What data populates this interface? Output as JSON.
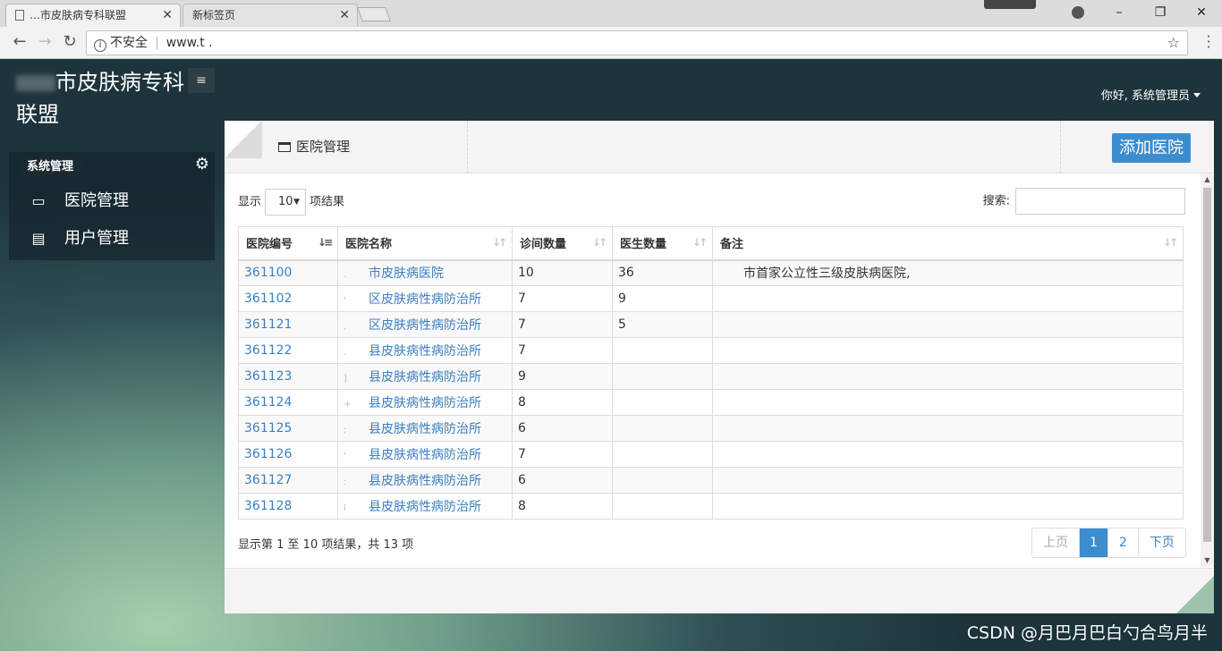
{
  "browser": {
    "tabs": [
      {
        "title": "…市皮肤病专科联盟",
        "active": true
      },
      {
        "title": "新标签页",
        "active": false
      }
    ],
    "security_label": "不安全",
    "url": "www.t  ."
  },
  "app": {
    "brand_suffix": "市皮肤病专科联盟",
    "greeting": "你好, 系统管理员"
  },
  "sidebar": {
    "group_label": "系统管理",
    "items": [
      {
        "label": "医院管理",
        "icon": "monitor-icon"
      },
      {
        "label": "用户管理",
        "icon": "document-icon"
      }
    ]
  },
  "panel": {
    "title": "医院管理",
    "add_button": "添加医院",
    "length_prefix": "显示",
    "length_value": "10",
    "length_suffix": "项结果",
    "search_label": "搜索:",
    "columns": [
      "医院编号",
      "医院名称",
      "诊间数量",
      "医生数量",
      "备注"
    ],
    "rows": [
      {
        "id": "361100",
        "prefix": ".",
        "name": "市皮肤病医院",
        "rooms": "10",
        "doctors": "36",
        "note": "市首家公立性三级皮肤病医院,"
      },
      {
        "id": "361102",
        "prefix": "'",
        "name": "区皮肤病性病防治所",
        "rooms": "7",
        "doctors": "9",
        "note": ""
      },
      {
        "id": "361121",
        "prefix": ",",
        "name": "区皮肤病性病防治所",
        "rooms": "7",
        "doctors": "5",
        "note": ""
      },
      {
        "id": "361122",
        "prefix": ".",
        "name": "县皮肤病性病防治所",
        "rooms": "7",
        "doctors": "",
        "note": ""
      },
      {
        "id": "361123",
        "prefix": "]",
        "name": "县皮肤病性病防治所",
        "rooms": "9",
        "doctors": "",
        "note": ""
      },
      {
        "id": "361124",
        "prefix": "+",
        "name": "县皮肤病性病防治所",
        "rooms": "8",
        "doctors": "",
        "note": ""
      },
      {
        "id": "361125",
        "prefix": ";",
        "name": "县皮肤病性病防治所",
        "rooms": "6",
        "doctors": "",
        "note": ""
      },
      {
        "id": "361126",
        "prefix": "'",
        "name": "县皮肤病性病防治所",
        "rooms": "7",
        "doctors": "",
        "note": ""
      },
      {
        "id": "361127",
        "prefix": ":",
        "name": "县皮肤病性病防治所",
        "rooms": "6",
        "doctors": "",
        "note": ""
      },
      {
        "id": "361128",
        "prefix": "i",
        "name": "县皮肤病性病防治所",
        "rooms": "8",
        "doctors": "",
        "note": ""
      }
    ],
    "info": "显示第 1 至 10 项结果，共 13 项",
    "pager": {
      "prev": "上页",
      "pages": [
        "1",
        "2"
      ],
      "next": "下页"
    }
  },
  "watermark": "CSDN @月巴月巴白勺合鸟月半"
}
